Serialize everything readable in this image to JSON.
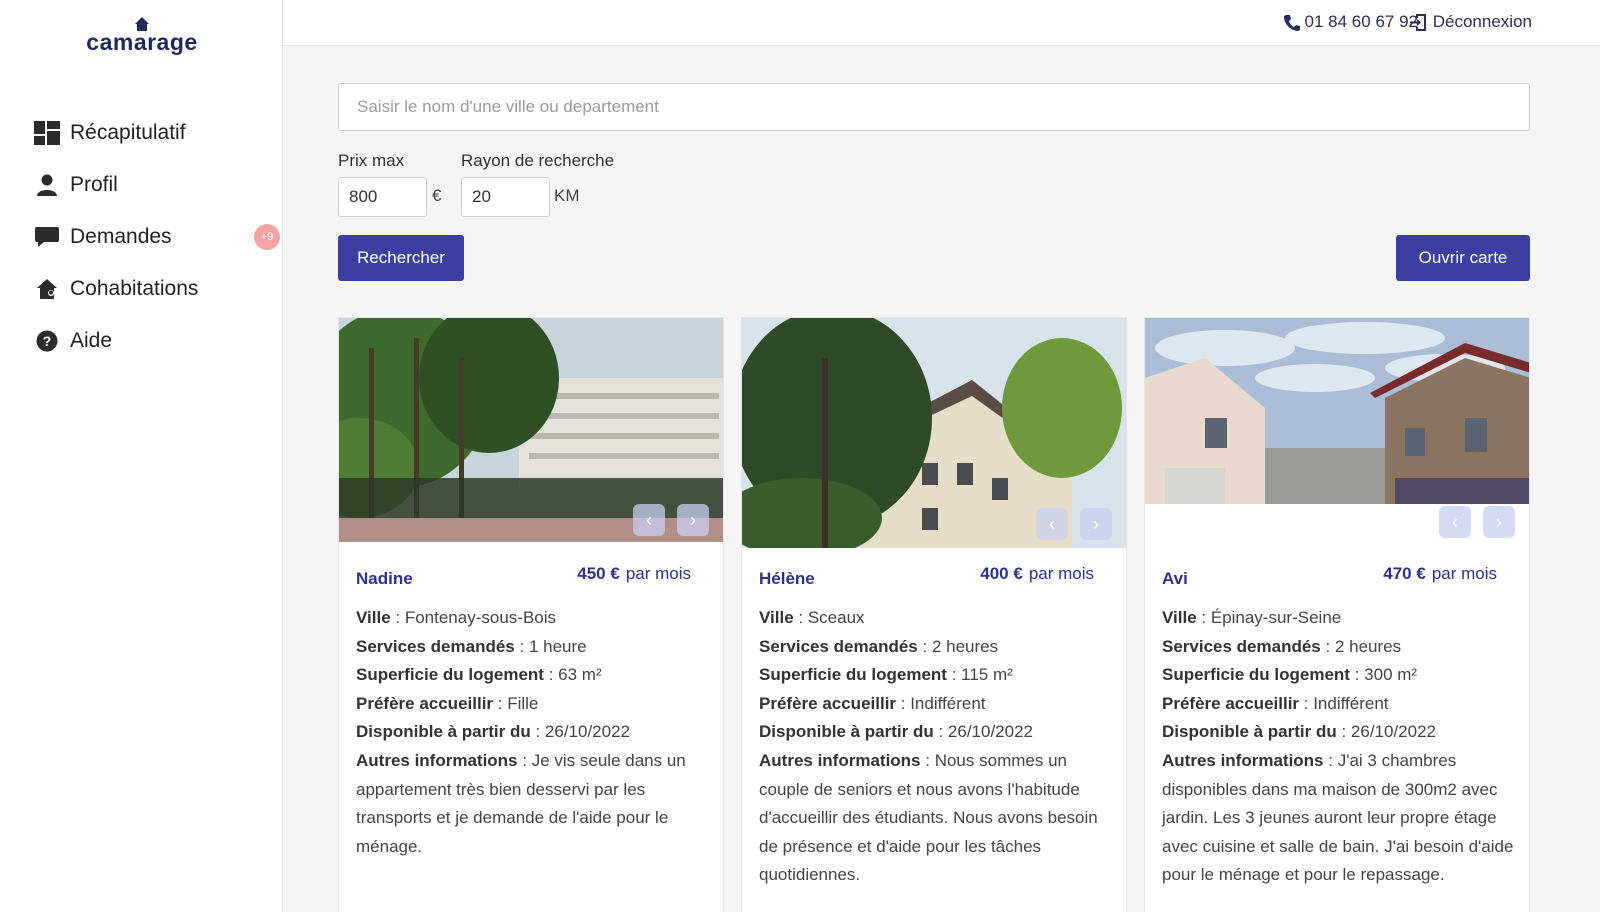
{
  "brand": {
    "name": "camarage"
  },
  "nav": [
    {
      "label": "Récapitulatif",
      "icon": "dashboard-icon"
    },
    {
      "label": "Profil",
      "icon": "user-icon"
    },
    {
      "label": "Demandes",
      "icon": "chat-icon",
      "badge": "+9"
    },
    {
      "label": "Cohabitations",
      "icon": "house-people-icon"
    },
    {
      "label": "Aide",
      "icon": "help-icon"
    }
  ],
  "topbar": {
    "phone": "01 84 60 67 92",
    "logout": "Déconnexion"
  },
  "search": {
    "placeholder": "Saisir le nom d'une ville ou departement",
    "price_label": "Prix max",
    "price_value": "800",
    "price_unit": "€",
    "radius_label": "Rayon de recherche",
    "radius_value": "20",
    "radius_unit": "KM",
    "search_button": "Rechercher",
    "map_button": "Ouvrir carte"
  },
  "labels": {
    "city": "Ville",
    "services": "Services demandés",
    "area": "Superficie du logement",
    "prefers": "Préfère accueillir",
    "available": "Disponible à partir du",
    "other": "Autres informations",
    "per_month": "par mois"
  },
  "listings": [
    {
      "name": "Nadine",
      "price": "450 €",
      "city": "Fontenay-sous-Bois",
      "services": "1 heure",
      "area": "63 m²",
      "prefers": "Fille",
      "available": "26/10/2022",
      "other": "Je vis seule dans un appartement très bien desservi par les transports et je demande de l'aide pour le ménage."
    },
    {
      "name": "Hélène",
      "price": "400 €",
      "city": "Sceaux",
      "services": "2 heures",
      "area": "115 m²",
      "prefers": "Indifférent",
      "available": "26/10/2022",
      "other": "Nous sommes un couple de seniors et nous avons l'habitude d'accueillir des étudiants. Nous avons besoin de présence et d'aide pour les tâches quotidiennes."
    },
    {
      "name": "Avi",
      "price": "470 €",
      "city": "Épinay-sur-Seine",
      "services": "2 heures",
      "area": "300 m²",
      "prefers": "Indifférent",
      "available": "26/10/2022",
      "other": "J'ai 3 chambres disponibles dans ma maison de 300m2 avec jardin. Les 3 jeunes auront leur propre étage avec cuisine et salle de bain. J'ai besoin d'aide pour le ménage et pour le repassage."
    }
  ]
}
